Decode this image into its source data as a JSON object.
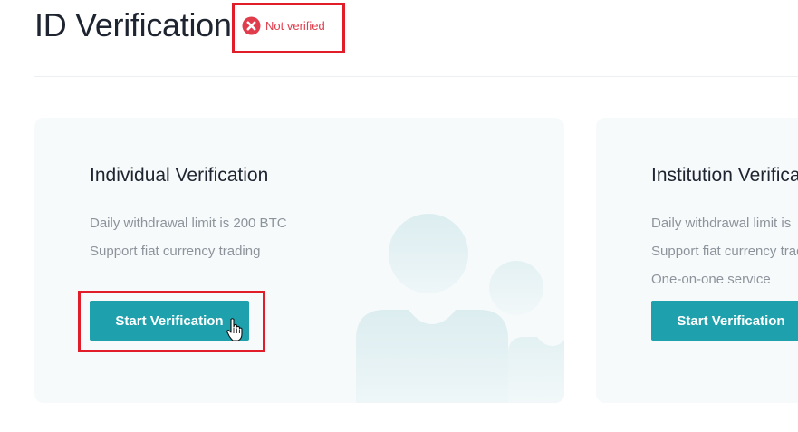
{
  "header": {
    "title": "ID Verification",
    "status": {
      "label": "Not verified",
      "icon": "error-circle-icon",
      "color": "#e03c4b"
    }
  },
  "cards": [
    {
      "title": "Individual Verification",
      "features": [
        "Daily withdrawal limit is 200 BTC",
        "Support fiat currency trading"
      ],
      "button_label": "Start Verification"
    },
    {
      "title": "Institution Verification",
      "features": [
        "Daily withdrawal limit is",
        "Support fiat currency trading",
        "One-on-one service"
      ],
      "button_label": "Start Verification"
    }
  ],
  "colors": {
    "accent": "#1fa1ad",
    "card_background": "#f6fafb",
    "highlight": "#e11d2a"
  }
}
